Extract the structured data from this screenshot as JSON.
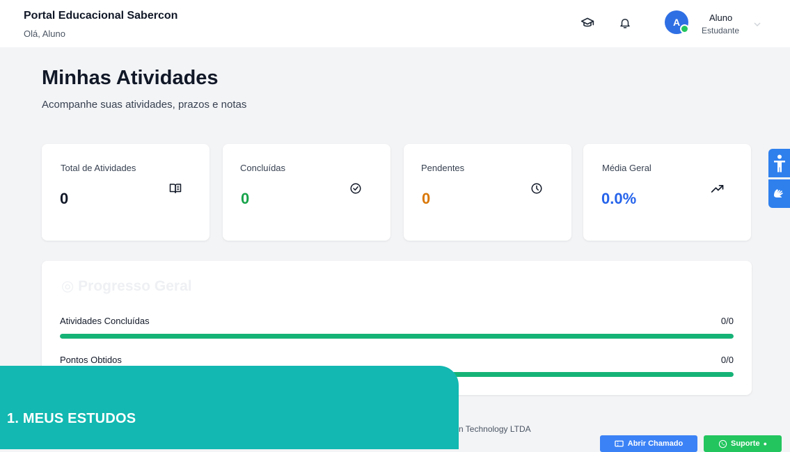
{
  "header": {
    "title": "Portal Educacional Sabercon",
    "greeting": "Olá, Aluno",
    "user": {
      "initial": "A",
      "name": "Aluno",
      "role": "Estudante"
    }
  },
  "page": {
    "title": "Minhas Atividades",
    "subtitle": "Acompanhe suas atividades, prazos e notas"
  },
  "stats": [
    {
      "label": "Total de Atividades",
      "value": "0",
      "color": "#111827",
      "icon": "book-open-icon"
    },
    {
      "label": "Concluídas",
      "value": "0",
      "color": "#16a34a",
      "icon": "check-circle-icon"
    },
    {
      "label": "Pendentes",
      "value": "0",
      "color": "#d97706",
      "icon": "clock-icon"
    },
    {
      "label": "Média Geral",
      "value": "0.0%",
      "color": "#2563eb",
      "icon": "trending-up-icon"
    }
  ],
  "progress": {
    "heading": "Progresso Geral",
    "rows": [
      {
        "label": "Atividades Concluídas",
        "count": "0/0",
        "fill_percent": 100
      },
      {
        "label": "Pontos Obtidos",
        "count": "0/0",
        "fill_percent": 100
      }
    ]
  },
  "footer": {
    "text": "n Technology LTDA",
    "chamado_label": "Abrir Chamado",
    "suporte_label": "Suporte"
  },
  "accessibility": [
    "accessibility-icon",
    "sign-language-icon"
  ],
  "overlay": {
    "text": "1.   MEUS ESTUDOS"
  },
  "colors": {
    "accent": "#2f6fe4",
    "progress": "#16b377",
    "overlay": "#12b8b1",
    "whatsapp": "#22c55e"
  }
}
